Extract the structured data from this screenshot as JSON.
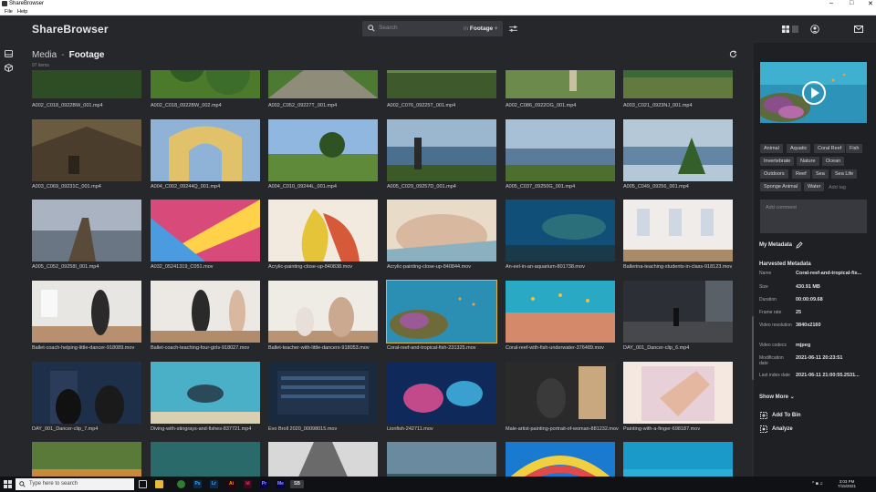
{
  "window": {
    "title": "ShareBrowser",
    "menu": [
      "File",
      "Help"
    ]
  },
  "header": {
    "logo": "ShareBrowser",
    "search_placeholder": "Search",
    "search_scope_prefix": "in",
    "search_scope": "Footage"
  },
  "breadcrumb": {
    "root": "Media",
    "separator": "-",
    "current": "Footage",
    "item_count": "97 items"
  },
  "grid": {
    "files": [
      "A002_C018_0922BW_001.mp4",
      "A002_C018_0922BW_002.mp4",
      "A002_C052_09227T_001.mp4",
      "A002_C076_09225T_001.mp4",
      "A002_C086_0922OG_001.mp4",
      "A003_C021_0923NJ_001.mp4",
      "A003_C069_09231C_001.mp4",
      "A004_C002_09244Q_001.mp4",
      "A004_C010_09244L_001.mp4",
      "A005_C029_09257D_001.mp4",
      "A005_C037_09250G_001.mp4",
      "A005_C049_09256_001.mp4",
      "A005_C052_09258I_001.mp4",
      "A032_05241319_C051.mov",
      "Acrylic-painting-close-up-840838.mov",
      "Acrylic-painting-close-up-840844.mov",
      "An-eel-in-an-aquarium-801738.mov",
      "Ballerina-teaching-students-in-class-918123.mov",
      "Ballet-coach-helping-little-dancer-918089.mov",
      "Ballet-coach-teaching-four-girls-918027.mov",
      "Ballet-teacher-with-little-dancers-918053.mov",
      "Coral-reef-and-tropical-fish-231325.mov",
      "Coral-reef-with-fish-underwater-376489.mov",
      "DAY_001_Dancer-clip_6.mp4",
      "DAY_001_Dancer-clip_7.mp4",
      "Diving-with-stingrays-and-fishes-837721.mp4",
      "Evo Broll 2020_00098015.mov",
      "Lionfish-242711.mov",
      "Male-artist-painting-portrait-of-woman-881232.mov",
      "Painting-with-a-finger-698187.mov",
      "",
      "",
      "",
      "",
      "",
      ""
    ]
  },
  "panel": {
    "tags": [
      "Animal",
      "Aquatic",
      "Coral Reef",
      "Fish",
      "Invertebrate",
      "Nature",
      "Ocean",
      "Outdoors",
      "Reef",
      "Sea",
      "Sea Life",
      "Sponge Animal",
      "Water"
    ],
    "add_tag": "Add tag",
    "comment_placeholder": "Add comment",
    "my_metadata": "My Metadata",
    "harvested_title": "Harvested Metadata",
    "metadata": [
      {
        "key": "Name",
        "value": "Coral-reef-and-tropical-fis..."
      },
      {
        "key": "Size",
        "value": "430.91 MB"
      },
      {
        "key": "Duration",
        "value": "00:00:09.68"
      },
      {
        "key": "Frame rate",
        "value": "25"
      },
      {
        "key": "Video resolution",
        "value": "3840x2160"
      },
      {
        "key": "Video codecs",
        "value": "mjpeg"
      },
      {
        "key": "Modification date",
        "value": "2021-06-11 20:23:51"
      },
      {
        "key": "Last index date",
        "value": "2021-06-11 21:00:55.2531..."
      }
    ],
    "show_more": "Show More",
    "add_to_bin": "Add To Bin",
    "analyze": "Analyze"
  },
  "taskbar": {
    "search_placeholder": "Type here to search",
    "apps": [
      "Ps",
      "Lr",
      "Ai",
      "Id",
      "Pr",
      "Me",
      "SB"
    ],
    "time": "3:03 PM",
    "date": "7/15/2021"
  },
  "colors": {
    "selection": "#e0b43a",
    "background": "#26272b",
    "panel": "#1f2024"
  }
}
